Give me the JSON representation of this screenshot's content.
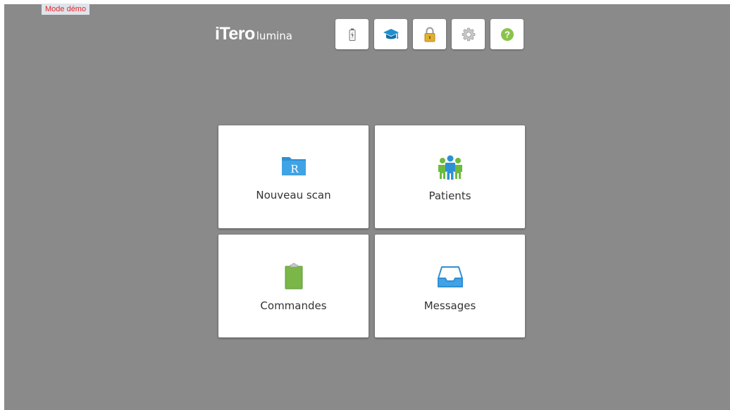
{
  "demo_badge": "Mode démo",
  "logo": {
    "main": "iTero",
    "sub": "lumina"
  },
  "toolbar": {
    "buttons": [
      {
        "name": "battery",
        "icon": "battery-icon"
      },
      {
        "name": "learning",
        "icon": "graduation-cap-icon"
      },
      {
        "name": "lock",
        "icon": "lock-icon"
      },
      {
        "name": "settings",
        "icon": "gear-icon"
      },
      {
        "name": "help",
        "icon": "help-icon"
      }
    ]
  },
  "tiles": {
    "new_scan": {
      "label": "Nouveau scan",
      "icon": "rx-folder-icon",
      "icon_letter": "R"
    },
    "patients": {
      "label": "Patients",
      "icon": "patients-group-icon"
    },
    "orders": {
      "label": "Commandes",
      "icon": "clipboard-icon"
    },
    "messages": {
      "label": "Messages",
      "icon": "inbox-tray-icon"
    }
  },
  "colors": {
    "background": "#8a8a8a",
    "accent_blue": "#3a9ad9",
    "accent_green": "#7ab648",
    "lock_gold": "#e2b030",
    "help_green": "#8bc34a",
    "demo_text": "#e3262e"
  }
}
